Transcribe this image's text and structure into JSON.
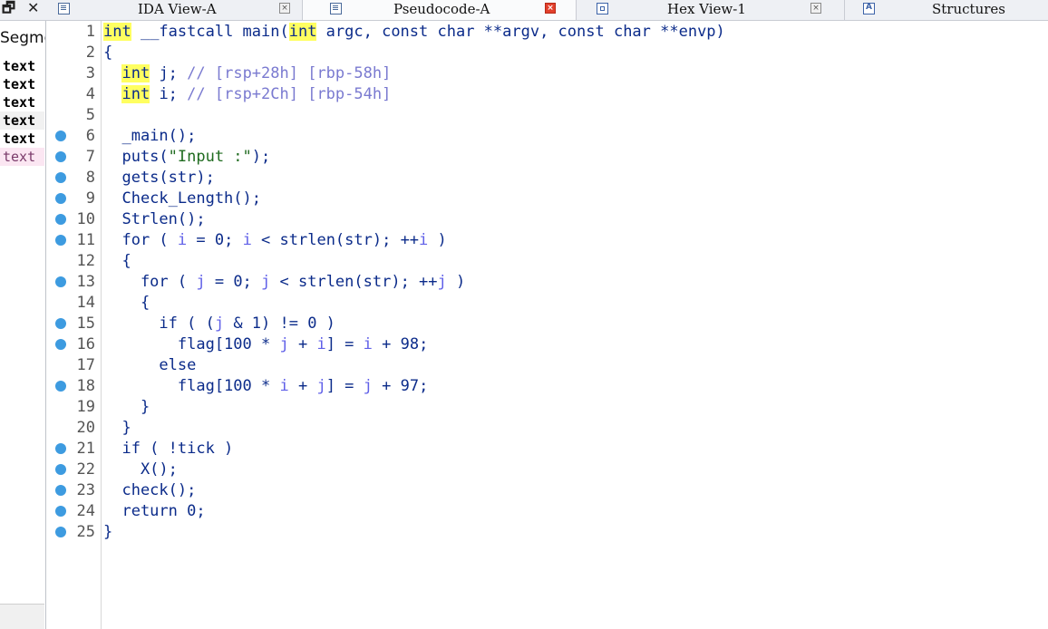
{
  "window_controls": {
    "restore": "🗗",
    "close": "✕"
  },
  "tabs": [
    {
      "label": "IDA View-A",
      "icon": "listing-icon",
      "close": "×",
      "active": false
    },
    {
      "label": "Pseudocode-A",
      "icon": "listing-icon",
      "close": "×",
      "active": true
    },
    {
      "label": "Hex View-1",
      "icon": "hex-icon",
      "close": "×",
      "active": false
    },
    {
      "label": "Structures",
      "icon": "struct-icon",
      "close": "",
      "active": false
    }
  ],
  "left_panel": {
    "header": "Segme",
    "rows": [
      {
        "text": "text",
        "style": "bold"
      },
      {
        "text": "text",
        "style": "bold"
      },
      {
        "text": "text",
        "style": "bold"
      },
      {
        "text": "text",
        "style": "bold alt"
      },
      {
        "text": "text",
        "style": "bold"
      },
      {
        "text": "text",
        "style": "pink"
      }
    ]
  },
  "colors": {
    "accent_blue": "#3d9be0",
    "keyword_highlight": "#ffff60",
    "code_text": "#0b2b8a",
    "comment": "#7a7ad0",
    "string": "#1f6b1f",
    "active_tab_close": "#e2402c"
  },
  "code_lines": [
    {
      "n": "1",
      "bp": false,
      "tokens": [
        [
          "kwh",
          "int"
        ],
        [
          "t",
          " __fastcall main("
        ],
        [
          "kwh",
          "int"
        ],
        [
          "t",
          " argc, const char **argv, const char **envp)"
        ]
      ]
    },
    {
      "n": "2",
      "bp": false,
      "tokens": [
        [
          "t",
          "{"
        ]
      ]
    },
    {
      "n": "3",
      "bp": false,
      "tokens": [
        [
          "t",
          "  "
        ],
        [
          "kwh",
          "int"
        ],
        [
          "t",
          " j; "
        ],
        [
          "cm",
          "// [rsp+28h] [rbp-58h]"
        ]
      ]
    },
    {
      "n": "4",
      "bp": false,
      "tokens": [
        [
          "t",
          "  "
        ],
        [
          "kwh",
          "int"
        ],
        [
          "t",
          " i; "
        ],
        [
          "cm",
          "// [rsp+2Ch] [rbp-54h]"
        ]
      ]
    },
    {
      "n": "5",
      "bp": false,
      "tokens": []
    },
    {
      "n": "6",
      "bp": true,
      "tokens": [
        [
          "t",
          "  _main();"
        ]
      ]
    },
    {
      "n": "7",
      "bp": true,
      "tokens": [
        [
          "t",
          "  puts("
        ],
        [
          "str",
          "\"Input :\""
        ],
        [
          "t",
          ");"
        ]
      ]
    },
    {
      "n": "8",
      "bp": true,
      "tokens": [
        [
          "t",
          "  gets(str);"
        ]
      ]
    },
    {
      "n": "9",
      "bp": true,
      "tokens": [
        [
          "t",
          "  Check_Length();"
        ]
      ]
    },
    {
      "n": "10",
      "bp": true,
      "tokens": [
        [
          "t",
          "  Strlen();"
        ]
      ]
    },
    {
      "n": "11",
      "bp": true,
      "tokens": [
        [
          "t",
          "  for ( "
        ],
        [
          "var",
          "i"
        ],
        [
          "t",
          " = 0; "
        ],
        [
          "var",
          "i"
        ],
        [
          "t",
          " < strlen(str); ++"
        ],
        [
          "var",
          "i"
        ],
        [
          "t",
          " )"
        ]
      ]
    },
    {
      "n": "12",
      "bp": false,
      "tokens": [
        [
          "t",
          "  {"
        ]
      ]
    },
    {
      "n": "13",
      "bp": true,
      "tokens": [
        [
          "t",
          "    for ( "
        ],
        [
          "var",
          "j"
        ],
        [
          "t",
          " = 0; "
        ],
        [
          "var",
          "j"
        ],
        [
          "t",
          " < strlen(str); ++"
        ],
        [
          "var",
          "j"
        ],
        [
          "t",
          " )"
        ]
      ]
    },
    {
      "n": "14",
      "bp": false,
      "tokens": [
        [
          "t",
          "    {"
        ]
      ]
    },
    {
      "n": "15",
      "bp": true,
      "tokens": [
        [
          "t",
          "      if ( ("
        ],
        [
          "var",
          "j"
        ],
        [
          "t",
          " & 1) != 0 )"
        ]
      ]
    },
    {
      "n": "16",
      "bp": true,
      "tokens": [
        [
          "t",
          "        flag[100 * "
        ],
        [
          "var",
          "j"
        ],
        [
          "t",
          " + "
        ],
        [
          "var",
          "i"
        ],
        [
          "t",
          "] = "
        ],
        [
          "var",
          "i"
        ],
        [
          "t",
          " + 98;"
        ]
      ]
    },
    {
      "n": "17",
      "bp": false,
      "tokens": [
        [
          "t",
          "      else"
        ]
      ]
    },
    {
      "n": "18",
      "bp": true,
      "tokens": [
        [
          "t",
          "        flag[100 * "
        ],
        [
          "var",
          "i"
        ],
        [
          "t",
          " + "
        ],
        [
          "var",
          "j"
        ],
        [
          "t",
          "] = "
        ],
        [
          "var",
          "j"
        ],
        [
          "t",
          " + 97;"
        ]
      ]
    },
    {
      "n": "19",
      "bp": false,
      "tokens": [
        [
          "t",
          "    }"
        ]
      ]
    },
    {
      "n": "20",
      "bp": false,
      "tokens": [
        [
          "t",
          "  }"
        ]
      ]
    },
    {
      "n": "21",
      "bp": true,
      "tokens": [
        [
          "t",
          "  if ( !tick )"
        ]
      ]
    },
    {
      "n": "22",
      "bp": true,
      "tokens": [
        [
          "t",
          "    X();"
        ]
      ]
    },
    {
      "n": "23",
      "bp": true,
      "tokens": [
        [
          "t",
          "  check();"
        ]
      ]
    },
    {
      "n": "24",
      "bp": true,
      "tokens": [
        [
          "t",
          "  return 0;"
        ]
      ]
    },
    {
      "n": "25",
      "bp": true,
      "tokens": [
        [
          "t",
          "}"
        ]
      ]
    }
  ]
}
